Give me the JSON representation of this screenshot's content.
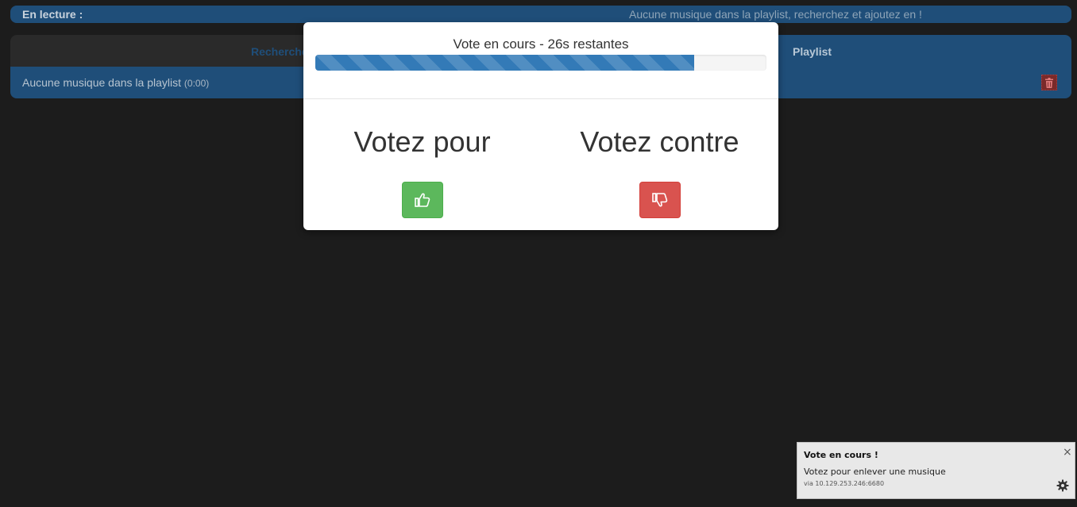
{
  "now_playing": {
    "label": "En lecture :",
    "message": "Aucune musique dans la playlist, recherchez et ajoutez en !"
  },
  "tabs": {
    "search_label": "Recherche",
    "playlist_label": "Playlist"
  },
  "playlist": {
    "items": [
      {
        "text": "Aucune musique dans la playlist",
        "duration": "(0:00)"
      }
    ],
    "delete_icon": "trash-icon"
  },
  "vote_modal": {
    "title": "Vote en cours - 26s restantes",
    "progress_fraction": 0.84,
    "vote_for_heading": "Votez pour",
    "vote_against_heading": "Votez contre",
    "vote_for_icon": "thumbs-up-icon",
    "vote_against_icon": "thumbs-down-icon"
  },
  "notification": {
    "title": "Vote en cours !",
    "body": "Votez pour enlever une musique",
    "source": "via 10.129.253.246:6680",
    "close_symbol": "×",
    "settings_icon": "gear-icon"
  },
  "colors": {
    "background": "#1c1c1c",
    "panel_blue": "#1f4e79",
    "progress": "#337ab7",
    "success": "#5cb85c",
    "danger": "#d9534f"
  }
}
